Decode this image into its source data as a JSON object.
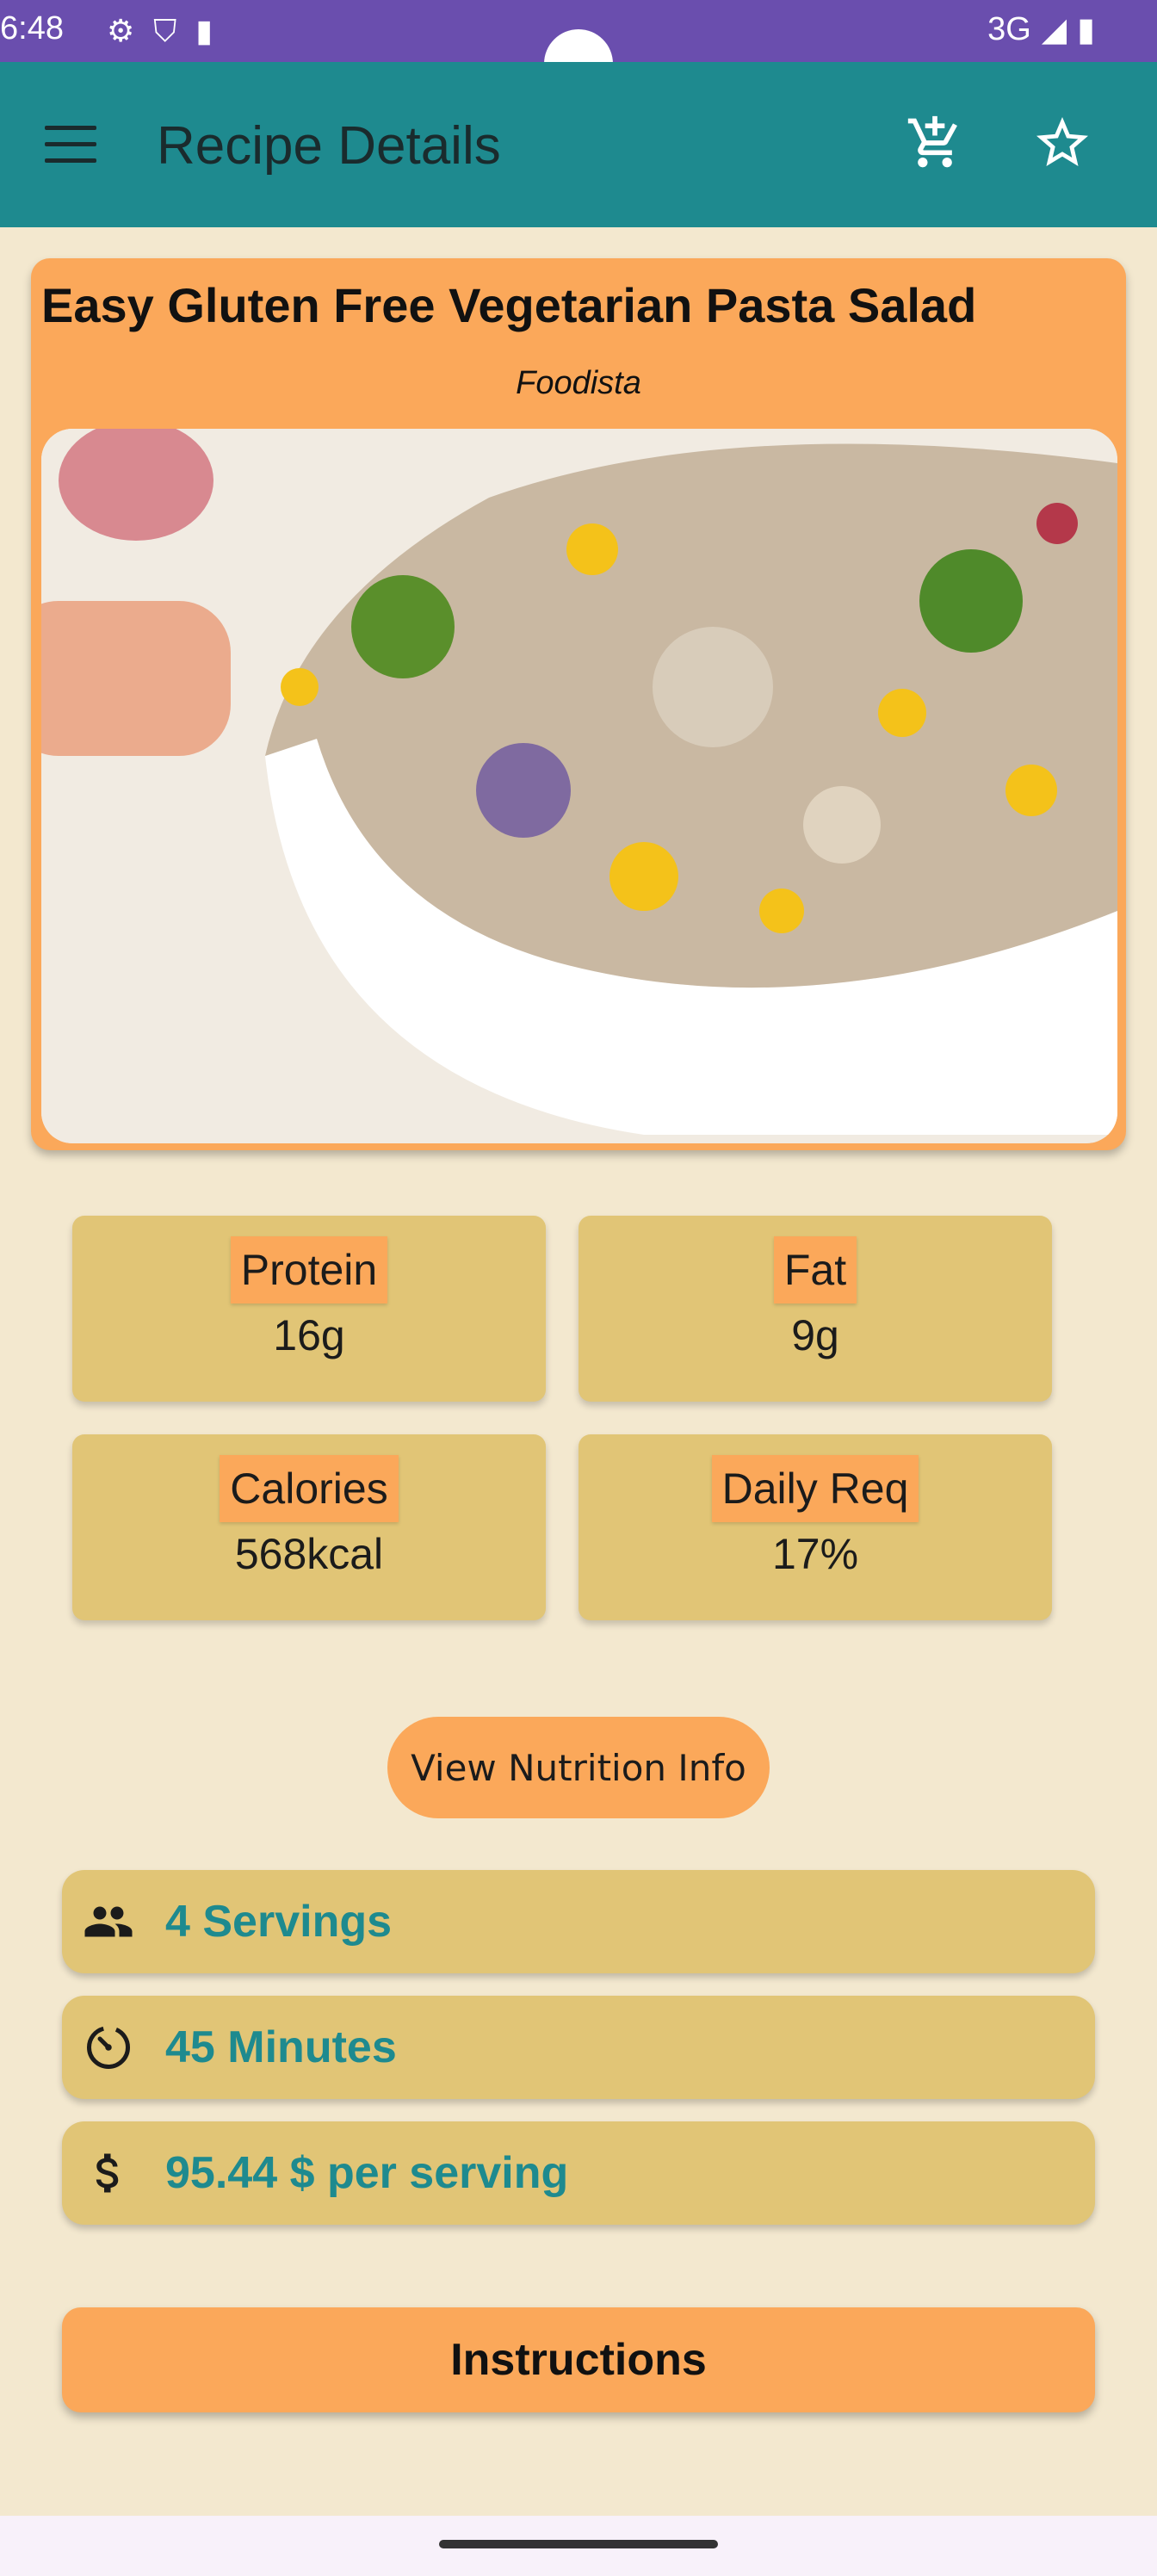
{
  "status_bar": {
    "time": "6:48",
    "network": "3G"
  },
  "app_bar": {
    "title": "Recipe Details"
  },
  "recipe": {
    "title": "Easy Gluten Free Vegetarian Pasta Salad",
    "source": "Foodista"
  },
  "stats": [
    {
      "label": "Protein",
      "value": "16g"
    },
    {
      "label": "Fat",
      "value": "9g"
    },
    {
      "label": "Calories",
      "value": "568kcal"
    },
    {
      "label": "Daily Req",
      "value": "17%"
    }
  ],
  "buttons": {
    "nutrition": "View Nutrition Info",
    "instructions": "Instructions"
  },
  "info": {
    "servings": "4 Servings",
    "time": "45 Minutes",
    "price": "95.44 $ per serving"
  },
  "colors": {
    "status_bar": "#6a4eae",
    "app_bar": "#1e8a8f",
    "background": "#f3e8cf",
    "card": "#fba85a",
    "tile": "#e1c576",
    "accent_text": "#1e8a8f"
  },
  "icons": [
    "menu-icon",
    "cart-add-icon",
    "star-icon",
    "people-icon",
    "timer-icon",
    "dollar-icon"
  ]
}
